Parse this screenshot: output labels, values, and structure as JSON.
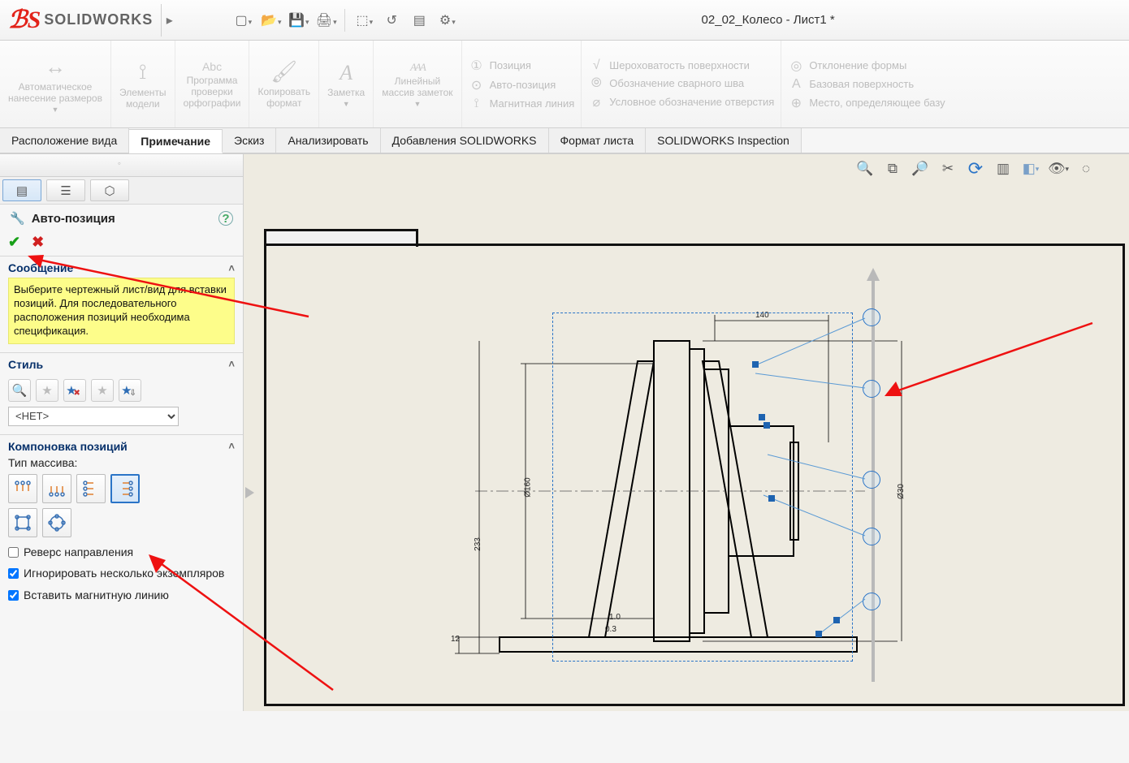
{
  "app": {
    "name": "SOLIDWORKS",
    "doc_title": "02_02_Колесо - Лист1 *"
  },
  "qat_icons": [
    "new-file",
    "open-file",
    "save",
    "print",
    "select",
    "rebuild",
    "options",
    "settings"
  ],
  "ribbon": {
    "big": [
      {
        "id": "auto-dim",
        "label": "Автоматическое\nнанесение размеров"
      },
      {
        "id": "model-items",
        "label": "Элементы\nмодели"
      },
      {
        "id": "spellcheck",
        "label": "Программа\nпроверки\nорфографии",
        "sub": "Abc"
      },
      {
        "id": "copy-format",
        "label": "Копировать\nформат"
      },
      {
        "id": "note",
        "label": "Заметка",
        "sub": "A"
      },
      {
        "id": "linear-note",
        "label": "Линейный\nмассив заметок",
        "sub": "AAA"
      }
    ],
    "col1": [
      {
        "id": "balloon",
        "icon": "①",
        "label": "Позиция"
      },
      {
        "id": "auto-balloon",
        "icon": "⊙",
        "label": "Авто-позиция"
      },
      {
        "id": "magnet-line",
        "icon": "⟟",
        "label": "Магнитная линия"
      }
    ],
    "col2": [
      {
        "id": "surface-finish",
        "icon": "√",
        "label": "Шероховатость поверхности"
      },
      {
        "id": "weld-symbol",
        "icon": "⦾",
        "label": "Обозначение сварного шва"
      },
      {
        "id": "hole-callout",
        "icon": "⌀",
        "label": "Условное обозначение отверстия"
      }
    ],
    "col3": [
      {
        "id": "form-tol",
        "icon": "◎",
        "label": "Отклонение формы"
      },
      {
        "id": "datum-feature",
        "icon": "A",
        "label": "Базовая поверхность"
      },
      {
        "id": "datum-target",
        "icon": "⊕",
        "label": "Место, определяющее базу"
      }
    ]
  },
  "tabs": [
    "Расположение вида",
    "Примечание",
    "Эскиз",
    "Анализировать",
    "Добавления SOLIDWORKS",
    "Формат листа",
    "SOLIDWORKS Inspection"
  ],
  "tabs_active_index": 1,
  "pm": {
    "title": "Авто-позиция",
    "message_h": "Сообщение",
    "message": "Выберите чертежный лист/вид для вставки позиций. Для последовательного расположения позиций необходима спецификация.",
    "style_h": "Стиль",
    "style_select": "<НЕТ>",
    "layout_h": "Компоновка позиций",
    "layout_label": "Тип массива:",
    "reverse": "Реверс направления",
    "ignore_multi": "Игнорировать несколько экземпляров",
    "insert_magnet": "Вставить магнитную линию"
  },
  "view_toolbar": [
    "zoom-fit",
    "zoom-window",
    "zoom-prev",
    "section-view",
    "rotate",
    "display-style",
    "view-cube",
    "hide-show",
    "appearance"
  ],
  "drawing": {
    "dims": {
      "width": "140",
      "height": "233",
      "dia1": "Ø160",
      "dia2": "Ø30",
      "h2": "1.0",
      "h1": "0.3",
      "b": "12"
    }
  }
}
